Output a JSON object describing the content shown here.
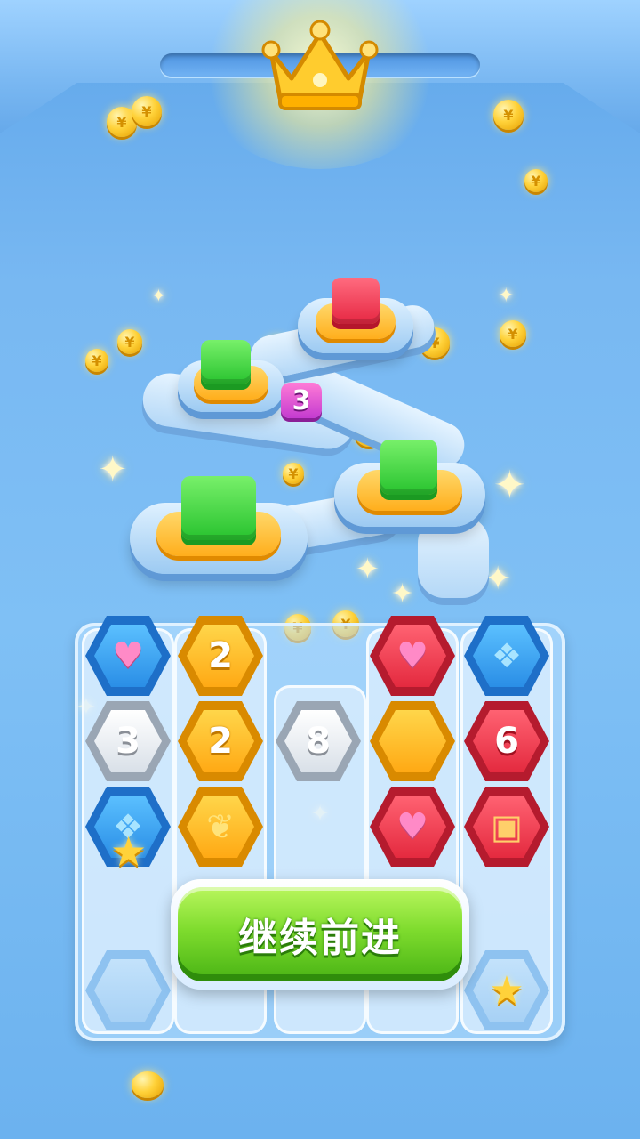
{
  "top": {
    "crown_icon": "crown-icon"
  },
  "map": {
    "level_badge": "3",
    "coin_symbol": "¥"
  },
  "board": {
    "columns": [
      [
        "heart",
        "2",
        "3"
      ],
      [
        "2",
        "2",
        "coin"
      ],
      [
        "8"
      ],
      [
        "heart",
        "",
        "heart"
      ],
      [
        "8",
        "6",
        "chest"
      ]
    ],
    "cells": {
      "c1r2": "2",
      "c2r1": "3",
      "c2r2": "2",
      "c2r3": "8",
      "c2r5": "6"
    }
  },
  "cta": {
    "label": "继续前进"
  },
  "colors": {
    "accent_green": "#7fdc2e",
    "tile_yellow": "#ffb81f",
    "tile_red": "#e42a3f",
    "tile_blue": "#2a8ee6"
  }
}
